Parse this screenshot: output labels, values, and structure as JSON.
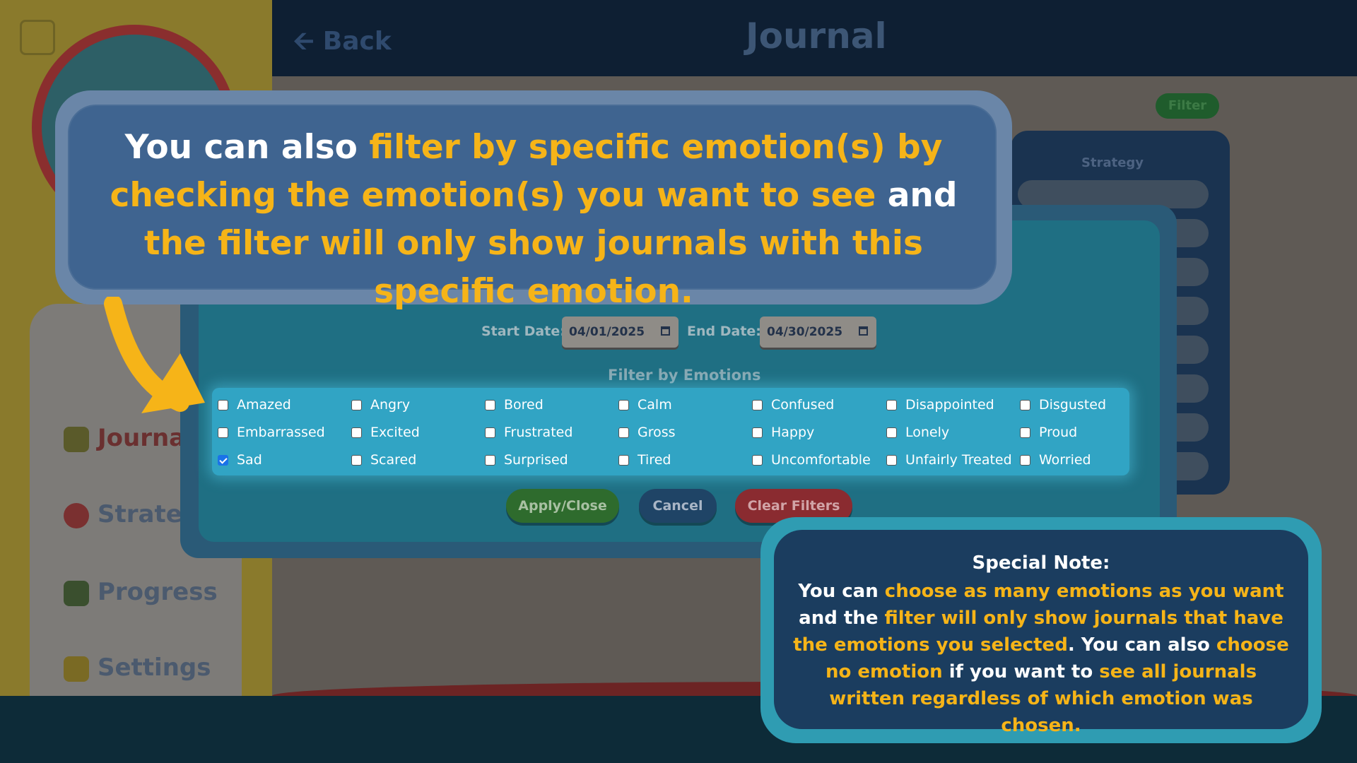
{
  "background_app": {
    "back_label": "Back",
    "page_title": "Journal",
    "filter_button": "Filter",
    "strategy_header": "Strategy",
    "nav": {
      "journal": "Journal",
      "strategies": "Strategies",
      "progress": "Progress",
      "settings": "Settings"
    }
  },
  "filter_modal": {
    "start_date_label": "Start Date:",
    "start_date_value": "04/01/2025",
    "end_date_label": "End Date:",
    "end_date_value": "04/30/2025",
    "emotions_title": "Filter by Emotions",
    "emotions": [
      {
        "label": "Amazed",
        "checked": false
      },
      {
        "label": "Angry",
        "checked": false
      },
      {
        "label": "Bored",
        "checked": false
      },
      {
        "label": "Calm",
        "checked": false
      },
      {
        "label": "Confused",
        "checked": false
      },
      {
        "label": "Disappointed",
        "checked": false
      },
      {
        "label": "Disgusted",
        "checked": false
      },
      {
        "label": "Embarrassed",
        "checked": false
      },
      {
        "label": "Excited",
        "checked": false
      },
      {
        "label": "Frustrated",
        "checked": false
      },
      {
        "label": "Gross",
        "checked": false
      },
      {
        "label": "Happy",
        "checked": false
      },
      {
        "label": "Lonely",
        "checked": false
      },
      {
        "label": "Proud",
        "checked": false
      },
      {
        "label": "Sad",
        "checked": true
      },
      {
        "label": "Scared",
        "checked": false
      },
      {
        "label": "Surprised",
        "checked": false
      },
      {
        "label": "Tired",
        "checked": false
      },
      {
        "label": "Uncomfortable",
        "checked": false
      },
      {
        "label": "Unfairly Treated",
        "checked": false
      },
      {
        "label": "Worried",
        "checked": false
      }
    ],
    "apply_label": "Apply/Close",
    "cancel_label": "Cancel",
    "clear_label": "Clear Filters"
  },
  "tutorial": {
    "main_callout": {
      "t1": "You can also ",
      "h1": "filter by specific emotion(s) by checking the emotion(s) you want to see",
      "t2": " and ",
      "h2": "the filter will only show journals with this specific emotion."
    },
    "note": {
      "title": "Special Note:",
      "t1": "You can ",
      "h1": "choose as many emotions as you want",
      "t2": " and the ",
      "h2": "filter will only show journals that have the emotions you selected",
      "t3": ". You can also ",
      "h3": "choose no emotion",
      "t4": " if you want to ",
      "h4": "see all journals written regardless of which emotion was chosen."
    }
  },
  "colors": {
    "highlight": "#f6b418",
    "checkbox_checked": "#1a73e8"
  }
}
